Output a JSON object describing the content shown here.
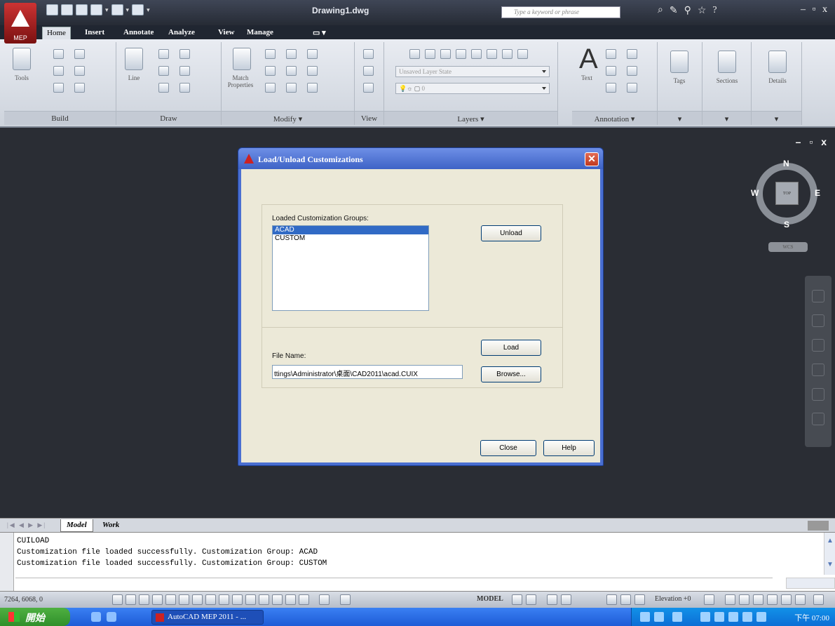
{
  "titlebar": {
    "app_logo_label": "MEP",
    "document_title": "Drawing1.dwg",
    "search_placeholder": "Type a keyword or phrase"
  },
  "ribbon_tabs": [
    "Home",
    "Insert",
    "Annotate",
    "Analyze",
    "View",
    "Manage"
  ],
  "ribbon_tab_extra": "▭ ▾",
  "ribbon_panels": {
    "build": "Build",
    "draw": "Draw",
    "modify": "Modify ▾",
    "view": "View",
    "layers": "Layers ▾",
    "annotation": "Annotation ▾",
    "p1": "▾",
    "p2": "▾",
    "p3": "▾"
  },
  "ribbon_big_labels": {
    "tools": "Tools",
    "line": "Line",
    "match_properties": "Match Properties",
    "text": "Text",
    "tags": "Tags",
    "sections": "Sections",
    "details": "Details"
  },
  "layer_state_combo": "Unsaved Layer State",
  "layer_combo": "0",
  "viewcube": {
    "top": "TOP",
    "north": "N",
    "south": "S",
    "east": "E",
    "west": "W",
    "wcs": "WCS"
  },
  "viewport_controls": "– ▫ x",
  "dialog": {
    "title": "Load/Unload Customizations",
    "close_x": "✕",
    "groups_label": "Loaded Customization Groups:",
    "groups": [
      "ACAD",
      "CUSTOM"
    ],
    "selected_index": 0,
    "unload_button": "Unload",
    "file_name_label": "File Name:",
    "file_name_value": "ttings\\Administrator\\桌面\\CAD2011\\acad.CUIX",
    "load_button": "Load",
    "browse_button": "Browse...",
    "close_button": "Close",
    "help_button": "Help"
  },
  "layout_tabs": {
    "nav": "|◀ ◀ ▶ ▶|",
    "model": "Model",
    "work": "Work"
  },
  "command_window": {
    "lines": [
      "CUILOAD",
      "Customization file loaded successfully. Customization Group: ACAD",
      "Customization file loaded successfully. Customization Group: CUSTOM"
    ]
  },
  "statusbar": {
    "coordinates": "7264, 6068, 0",
    "model_label": "MODEL",
    "elevation_label": "Elevation +0"
  },
  "taskbar": {
    "start_label": "開始",
    "app_button": "AutoCAD MEP 2011 - ...",
    "clock": "下午 07:00"
  }
}
